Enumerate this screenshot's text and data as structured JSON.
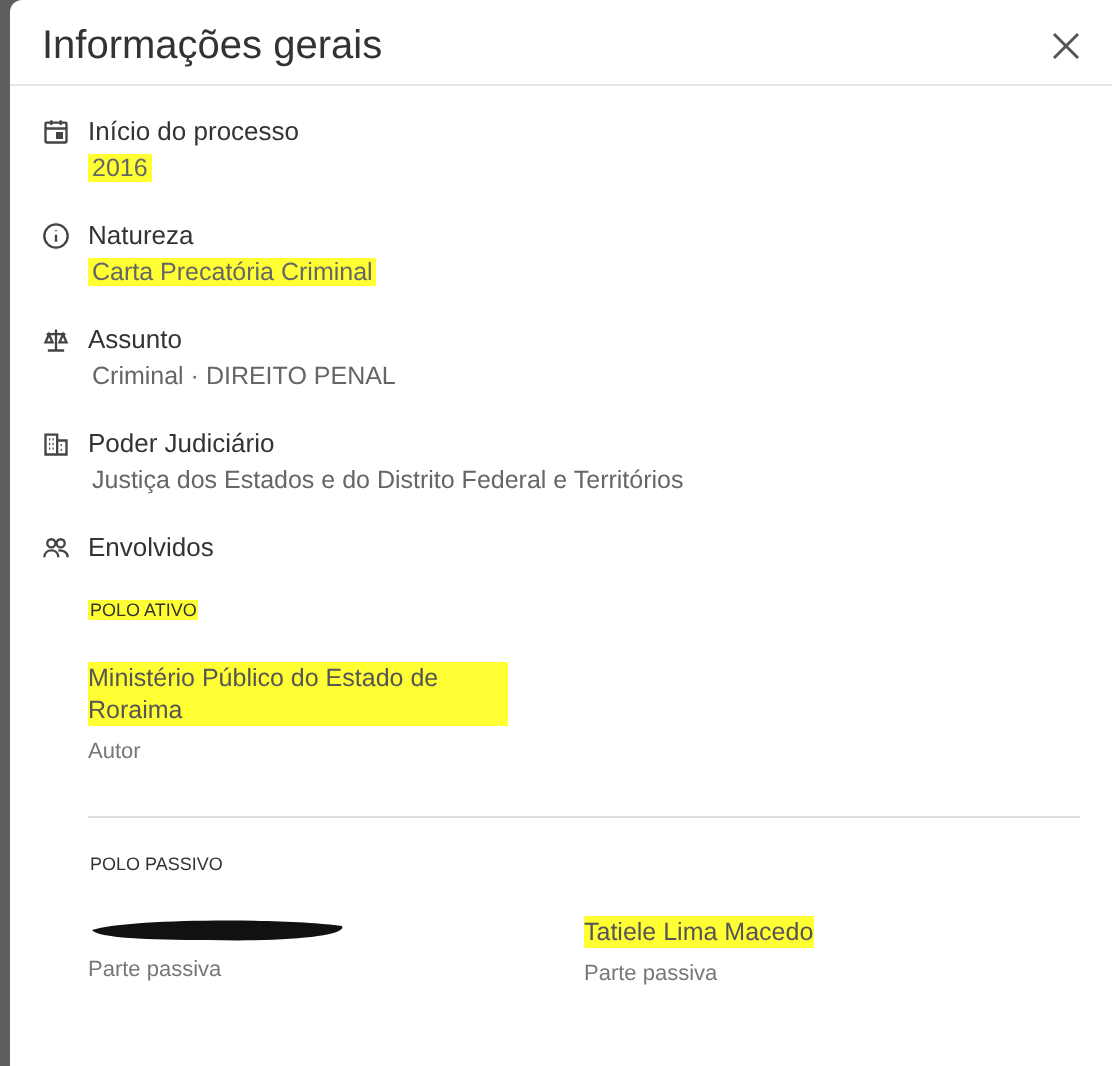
{
  "dialog": {
    "title": "Informações gerais"
  },
  "fields": [
    {
      "kind": "calendar",
      "label": "Início do processo",
      "value": "2016",
      "highlighted": true
    },
    {
      "kind": "info",
      "label": "Natureza",
      "value": "Carta Precatória Criminal",
      "highlighted": true
    },
    {
      "kind": "scale",
      "label": "Assunto",
      "value": "Criminal · DIREITO PENAL",
      "highlighted": false
    },
    {
      "kind": "building",
      "label": "Poder Judiciário",
      "value": "Justiça dos Estados e do Distrito Federal e Territórios",
      "highlighted": false
    }
  ],
  "involved": {
    "label": "Envolvidos",
    "poles": [
      {
        "label": "POLO ATIVO",
        "highlighted": true,
        "parties": [
          {
            "name": "Ministério Público do Estado de Roraima",
            "role": "Autor",
            "highlighted": true,
            "redacted": false
          }
        ]
      },
      {
        "label": "POLO PASSIVO",
        "highlighted": false,
        "parties": [
          {
            "role": "Parte passiva",
            "redacted": true
          },
          {
            "name": "Tatiele Lima Macedo",
            "role": "Parte passiva",
            "highlighted": true,
            "redacted": false
          }
        ]
      }
    ]
  }
}
